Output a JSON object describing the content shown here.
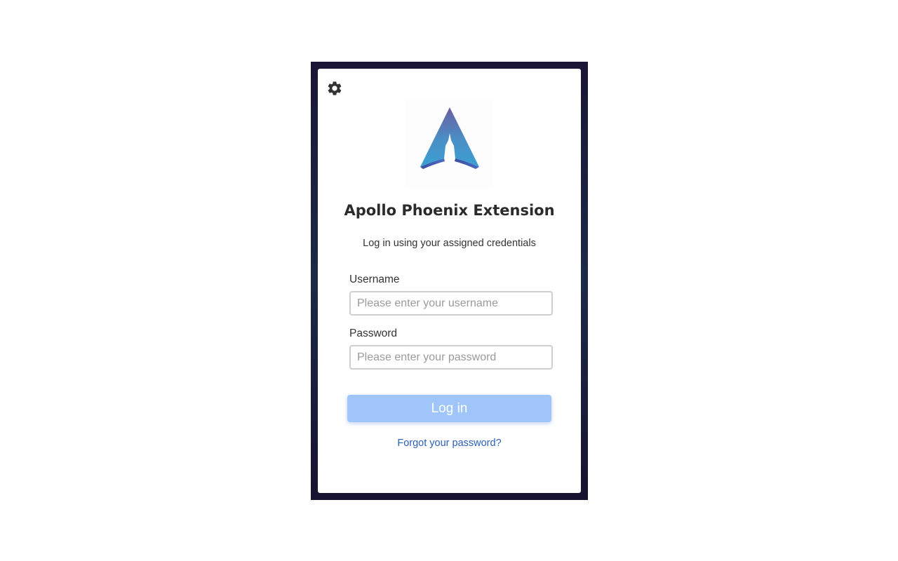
{
  "header": {
    "settings_icon": "gear-icon",
    "logo_icon": "apollo-rocket-logo-icon"
  },
  "title": "Apollo Phoenix Extension",
  "subtitle": "Log in using your assigned credentials",
  "form": {
    "username_label": "Username",
    "username_placeholder": "Please enter your username",
    "username_value": "",
    "password_label": "Password",
    "password_placeholder": "Please enter your password",
    "password_value": "",
    "login_label": "Log in",
    "forgot_label": "Forgot your password?"
  },
  "colors": {
    "frame": "#1c2040",
    "button": "#a0c5fb",
    "link": "#2a5fb8",
    "logo_top": "#6b5fa0",
    "logo_bottom": "#3f9cd0"
  }
}
